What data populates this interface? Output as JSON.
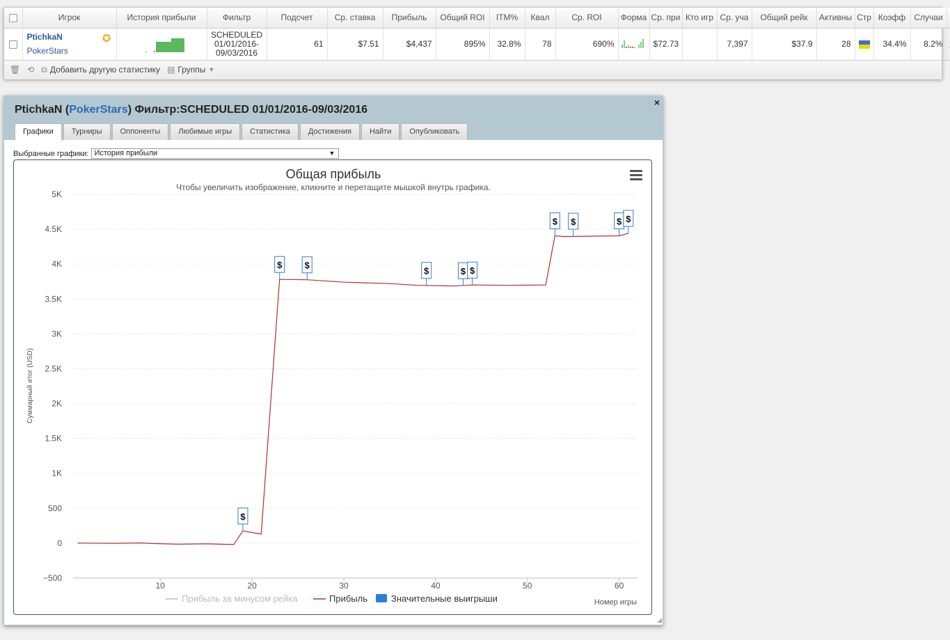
{
  "stats_table": {
    "headers": [
      "Игрок",
      "История прибыли",
      "Фильтр",
      "Подсчет",
      "Ср. ставка",
      "Прибыль",
      "Общий ROI",
      "ITM%",
      "Квал",
      "Ср. ROI",
      "Форма",
      "Ср. при",
      "Кто игр",
      "Ср. уча",
      "Общий рейк",
      "Активны",
      "Стр",
      "Коэфф",
      "Случаи"
    ],
    "row": {
      "player_name": "PtichkaN",
      "site": "PokerStars",
      "filter": "SCHEDULED 01/01/2016-09/03/2016",
      "count": "61",
      "avg_stake": "$7.51",
      "profit": "$4,437",
      "total_roi": "895%",
      "itm": "32.8%",
      "qual": "78",
      "avg_roi": "690%",
      "avg_prize": "$72.73",
      "who_plays": "",
      "avg_entrants": "7,397",
      "total_rake": "$37.9",
      "active": "28",
      "coeff": "34.4%",
      "cases": "8.2%",
      "remove_link": "x"
    },
    "icons": {
      "award": "award-ribbon-icon",
      "flag": "ukraine-flag-icon"
    },
    "colors": {
      "flag_blue": "#3a6fd0",
      "flag_yellow": "#f5d400",
      "history_bar": "#5cb85c",
      "form_green": "#7ed07e",
      "form_red": "#d9534f"
    }
  },
  "toolbar": {
    "add_stat_label": "Добавить другую статистику",
    "groups_label": "Группы"
  },
  "panel": {
    "title_player": "PtichkaN",
    "title_open_paren": " (",
    "title_site": "PokerStars",
    "title_close_paren": ")",
    "title_filter": " Фильтр:SCHEDULED 01/01/2016-09/03/2016",
    "close_symbol": "×",
    "tabs": [
      "Графики",
      "Турниры",
      "Оппоненты",
      "Любимые игры",
      "Статистика",
      "Достижения",
      "Найти",
      "Опубликовать"
    ],
    "active_tab": "Графики",
    "select_label": "Выбранные графики:",
    "select_value": "История прибыли",
    "accent_color": "#2c6bb8",
    "header_color": "#b4c8d2"
  },
  "chart_data": {
    "type": "line",
    "title": "Общая прибыль",
    "subtitle": "Чтобы увеличить изображение, кликните и перетащите мышкой внутрь графика.",
    "xlabel": "Номер игры",
    "ylabel": "Суммарный итог (USD)",
    "xlim": [
      0.5,
      62
    ],
    "ylim": [
      -500,
      5000
    ],
    "x_ticks": [
      10,
      20,
      30,
      40,
      50,
      60
    ],
    "y_ticks": [
      -500,
      0,
      500,
      1000,
      1500,
      2000,
      2500,
      3000,
      3500,
      4000,
      4500,
      5000
    ],
    "y_tick_labels": [
      "−500",
      "0",
      "500",
      "1K",
      "1.5K",
      "2K",
      "2.5K",
      "3K",
      "3.5K",
      "4K",
      "4.5K",
      "5K"
    ],
    "grid": true,
    "legend_position": "bottom",
    "series": [
      {
        "name": "Прибыль за минусом рейка",
        "color": "#cccccc",
        "visible": false,
        "x": [],
        "y": []
      },
      {
        "name": "Прибыль",
        "color": "#b03030",
        "visible": true,
        "x": [
          1,
          5,
          8,
          9,
          12,
          15,
          18,
          19,
          21,
          23,
          26,
          30,
          35,
          38,
          40,
          42,
          44,
          48,
          52,
          53,
          54,
          57,
          60,
          61
        ],
        "y": [
          0,
          -2,
          3,
          -5,
          -15,
          -10,
          -20,
          175,
          130,
          3780,
          3775,
          3740,
          3720,
          3695,
          3690,
          3685,
          3700,
          3695,
          3700,
          4405,
          4395,
          4400,
          4405,
          4440
        ]
      }
    ],
    "big_wins": {
      "name": "Значительные выигрыши",
      "color": "#2f7ed8",
      "label": "$",
      "x": [
        19,
        23,
        26,
        39,
        43,
        44,
        53,
        55,
        60,
        61
      ],
      "y": [
        175,
        3780,
        3775,
        3695,
        3690,
        3700,
        4405,
        4400,
        4405,
        4440
      ]
    },
    "menu_icon": "hamburger-menu-icon"
  }
}
